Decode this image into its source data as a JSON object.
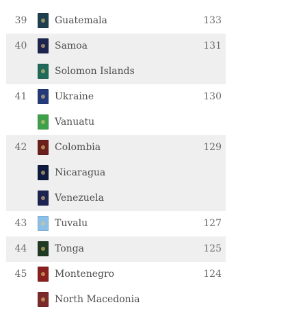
{
  "ranking": {
    "groups": [
      {
        "rank": "39",
        "score": "133",
        "shaded": false,
        "countries": [
          {
            "name": "Guatemala",
            "passport_color": "#1f3f4f"
          }
        ]
      },
      {
        "rank": "40",
        "score": "131",
        "shaded": true,
        "countries": [
          {
            "name": "Samoa",
            "passport_color": "#1c2450"
          },
          {
            "name": "Solomon Islands",
            "passport_color": "#1f6a5a"
          }
        ]
      },
      {
        "rank": "41",
        "score": "130",
        "shaded": false,
        "countries": [
          {
            "name": "Ukraine",
            "passport_color": "#243a7a"
          },
          {
            "name": "Vanuatu",
            "passport_color": "#3fa04a"
          }
        ]
      },
      {
        "rank": "42",
        "score": "129",
        "shaded": true,
        "countries": [
          {
            "name": "Colombia",
            "passport_color": "#6a1f1c"
          },
          {
            "name": "Nicaragua",
            "passport_color": "#0f1a3f"
          },
          {
            "name": "Venezuela",
            "passport_color": "#1c2350"
          }
        ]
      },
      {
        "rank": "43",
        "score": "127",
        "shaded": false,
        "countries": [
          {
            "name": "Tuvalu",
            "passport_color": "#8cc0e8"
          }
        ]
      },
      {
        "rank": "44",
        "score": "125",
        "shaded": true,
        "countries": [
          {
            "name": "Tonga",
            "passport_color": "#1f3a22"
          }
        ]
      },
      {
        "rank": "45",
        "score": "124",
        "shaded": false,
        "countries": [
          {
            "name": "Montenegro",
            "passport_color": "#8a1f1f"
          },
          {
            "name": "North Macedonia",
            "passport_color": "#7a2a2a"
          }
        ]
      }
    ]
  }
}
